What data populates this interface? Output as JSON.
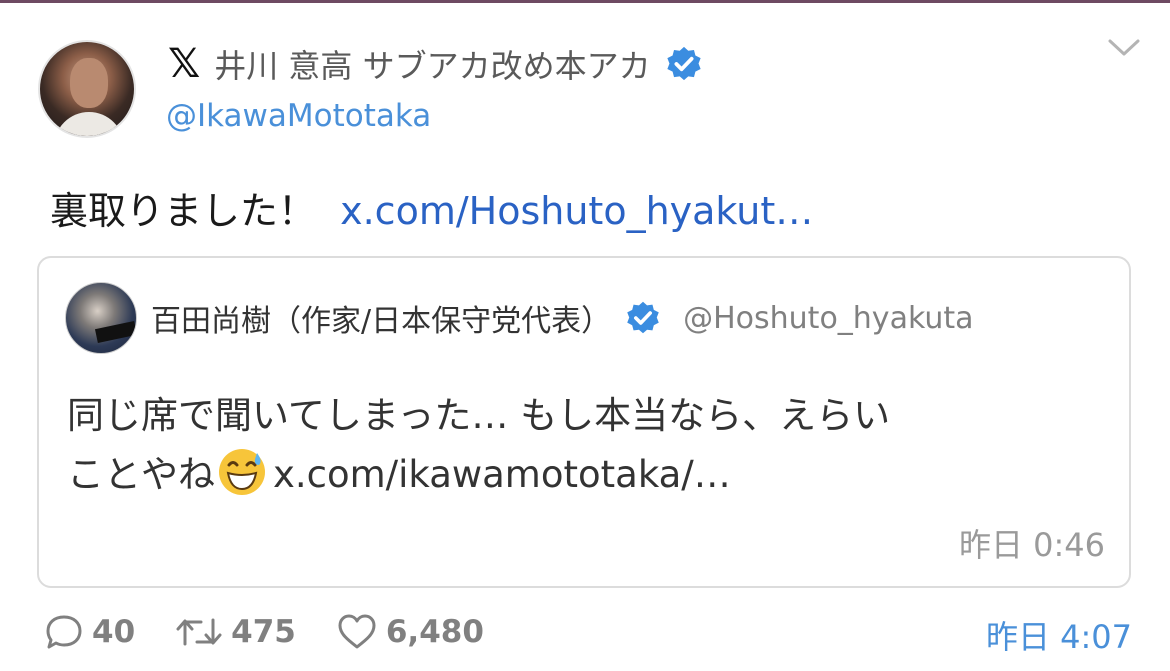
{
  "tweet": {
    "platform_logo": "𝕏",
    "author_name": "井川 意高 サブアカ改め本アカ",
    "verified_icon": "verified-badge-icon",
    "handle": "@IkawaMototaka",
    "text": "裏取りました！",
    "link": "x.com/Hoshuto_hyakut…",
    "timestamp": "昨日 4:07",
    "metrics": {
      "replies": "40",
      "retweets": "475",
      "likes": "6,480"
    }
  },
  "quoted": {
    "author_name": "百田尚樹（作家/日本保守党代表）",
    "handle": "@Hoshuto_hyakuta",
    "text_line1": "同じ席で聞いてしまった… もし本当なら、えらい",
    "text_line2": "ことやね",
    "emoji": "😅",
    "link": "x.com/ikawamototaka/…",
    "timestamp": "昨日 0:46"
  },
  "colors": {
    "link_blue": "#2a62c4",
    "handle_blue": "#4a90d9",
    "verified_blue": "#3b8de0",
    "muted_gray": "#808080",
    "border": "#dcdcdc"
  }
}
